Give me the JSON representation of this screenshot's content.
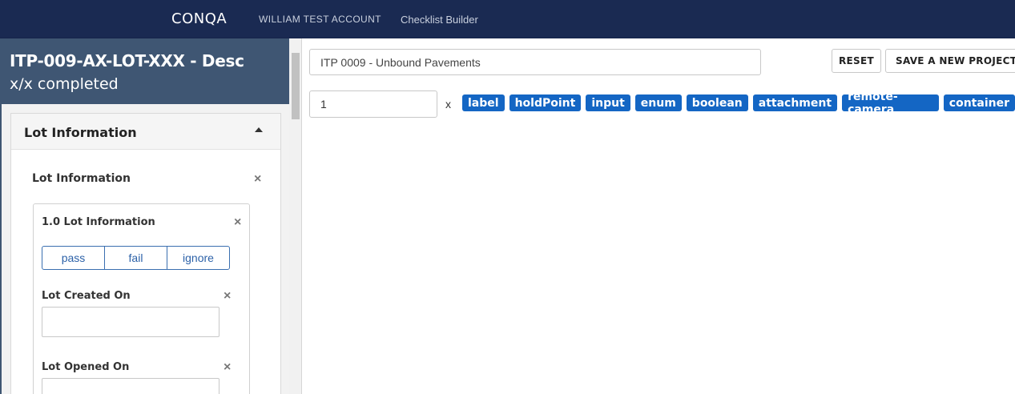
{
  "nav": {
    "logo": "CONQA",
    "account": "WILLIAM TEST ACCOUNT",
    "builder": "Checklist Builder"
  },
  "sidebar": {
    "itp_title": "ITP-009-AX-LOT-XXX - Desc",
    "progress": "x/x completed",
    "card_title": "Lot Information",
    "section_title": "Lot Information",
    "remove_symbol": "×",
    "inner": {
      "title": "1.0 Lot Information",
      "options": [
        "pass",
        "fail",
        "ignore"
      ],
      "fields": [
        {
          "label": "Lot Created On",
          "value": ""
        },
        {
          "label": "Lot Opened On",
          "value": ""
        }
      ]
    }
  },
  "main": {
    "checklist_title": "ITP 0009 - Unbound Pavements",
    "reset_label": "RESET",
    "save_label": "SAVE A NEW PROJECT CHECKLIST",
    "quantity": "1",
    "times_symbol": "x",
    "tags": [
      "label",
      "holdPoint",
      "input",
      "enum",
      "boolean",
      "attachment",
      "remote-camera",
      "container"
    ]
  },
  "colors": {
    "nav_bg": "#1a2a52",
    "sidebar_header_bg": "#3f5673",
    "tag_bg": "#1466c4",
    "option_border": "#3a6fb0"
  }
}
